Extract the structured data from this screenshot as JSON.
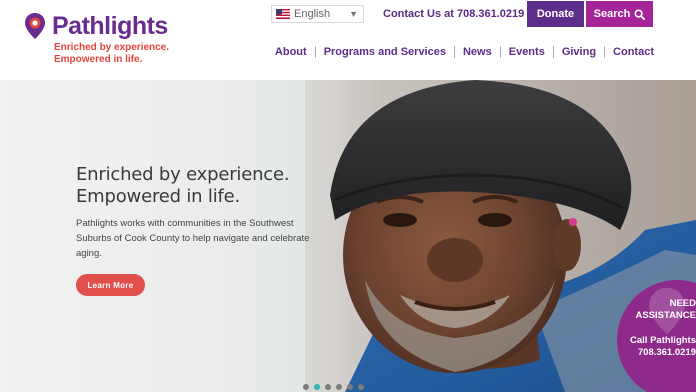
{
  "header": {
    "logo": {
      "name": "Pathlights",
      "tagline_line1": "Enriched by experience.",
      "tagline_line2": "Empowered in life."
    },
    "language": {
      "selected": "English",
      "flag_icon": "us-flag-icon"
    },
    "contact": "Contact Us at 708.361.0219",
    "donate_label": "Donate",
    "search_label": "Search",
    "nav": [
      "About",
      "Programs and Services",
      "News",
      "Events",
      "Giving",
      "Contact"
    ]
  },
  "hero": {
    "heading_line1": "Enriched by experience.",
    "heading_line2": "Empowered in life.",
    "description": "Pathlights works with communities in the Southwest Suburbs of Cook County to help navigate and celebrate aging.",
    "button_label": "Learn More",
    "slides_count": 6,
    "active_slide": 2
  },
  "assistance": {
    "line1": "NEED",
    "line2": "ASSISTANCE",
    "line3": "Call Pathlights",
    "phone": "708.361.0219"
  },
  "colors": {
    "brand_purple": "#6b2c8f",
    "search_magenta": "#a52598",
    "accent_red": "#e1504b",
    "dot_active": "#2ab7b5"
  }
}
